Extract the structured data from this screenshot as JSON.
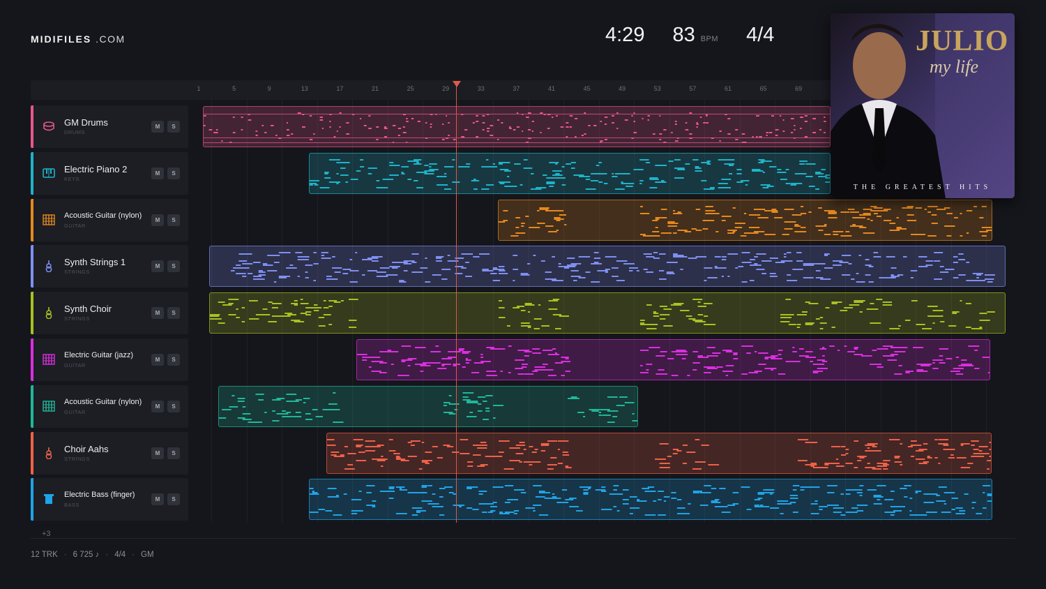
{
  "brand": {
    "name_bold": "MIDIFILES",
    "name_rest": ".COM"
  },
  "transport": {
    "duration": "4:29",
    "bpm": "83",
    "bpm_unit": "BPM",
    "time_signature": "4/4"
  },
  "ruler": {
    "bars": [
      "1",
      "5",
      "9",
      "13",
      "17",
      "21",
      "25",
      "29",
      "33",
      "37",
      "41",
      "45",
      "49",
      "53",
      "57",
      "61",
      "65",
      "69"
    ]
  },
  "tracks": [
    {
      "name": "GM Drums",
      "category": "DRUMS",
      "color": "#e8558f",
      "icon": "drum-icon",
      "mute": "M",
      "solo": "S"
    },
    {
      "name": "Electric Piano 2",
      "category": "KEYS",
      "color": "#1fb3c9",
      "icon": "piano-icon",
      "mute": "M",
      "solo": "S"
    },
    {
      "name": "Acoustic Guitar (nylon)",
      "category": "GUITAR",
      "color": "#e6891e",
      "icon": "guitar-fretboard-icon",
      "mute": "M",
      "solo": "S"
    },
    {
      "name": "Synth Strings 1",
      "category": "STRINGS",
      "color": "#7f8ff2",
      "icon": "strings-icon",
      "mute": "M",
      "solo": "S"
    },
    {
      "name": "Synth Choir",
      "category": "STRINGS",
      "color": "#a9c122",
      "icon": "strings-icon",
      "mute": "M",
      "solo": "S"
    },
    {
      "name": "Electric Guitar (jazz)",
      "category": "GUITAR",
      "color": "#db2ee0",
      "icon": "guitar-fretboard-icon",
      "mute": "M",
      "solo": "S"
    },
    {
      "name": "Acoustic Guitar (nylon)",
      "category": "GUITAR",
      "color": "#1fb89a",
      "icon": "guitar-fretboard-icon",
      "mute": "M",
      "solo": "S"
    },
    {
      "name": "Choir Aahs",
      "category": "STRINGS",
      "color": "#ef6148",
      "icon": "strings-icon",
      "mute": "M",
      "solo": "S"
    },
    {
      "name": "Electric Bass (finger)",
      "category": "BASS",
      "color": "#1fa4e8",
      "icon": "bass-icon",
      "mute": "M",
      "solo": "S"
    }
  ],
  "more_tracks": "+3",
  "footer": {
    "tracks": "12 TRK",
    "notes": "6 725 ♪",
    "meter": "4/4",
    "standard": "GM"
  },
  "album": {
    "title": "JULIO",
    "subtitle": "my life",
    "caption": "THE GREATEST HITS"
  }
}
